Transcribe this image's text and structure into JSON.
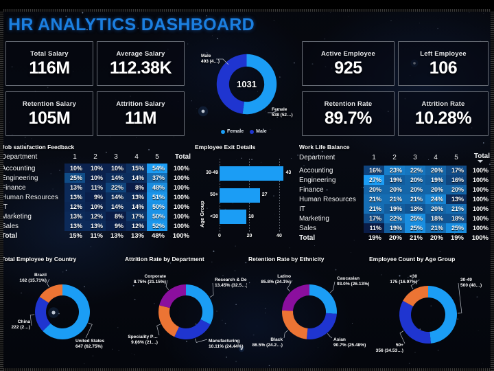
{
  "header": {
    "title": "HR ANALYTICS DASHBOARD",
    "accent": "#1b7fe0"
  },
  "kpis": [
    {
      "name": "total-salary",
      "label": "Total Salary",
      "value": "116M"
    },
    {
      "name": "average-salary",
      "label": "Average Salary",
      "value": "112.38K"
    },
    {
      "name": "retention-salary",
      "label": "Retention Salary",
      "value": "105M"
    },
    {
      "name": "attrition-salary",
      "label": "Attrition Salary",
      "value": "11M"
    },
    {
      "name": "active-employee",
      "label": "Active Employee",
      "value": "925"
    },
    {
      "name": "left-employee",
      "label": "Left Employee",
      "value": "106"
    },
    {
      "name": "retention-rate",
      "label": "Retention Rate",
      "value": "89.7%"
    },
    {
      "name": "attrition-rate",
      "label": "Attrition Rate",
      "value": "10.28%"
    }
  ],
  "gender_chart": {
    "type": "pie",
    "title": "",
    "center_total": "1031",
    "legend": [
      "Female",
      "Male"
    ],
    "legend_position": "bottom",
    "categories": [
      "Female",
      "Male"
    ],
    "values": [
      538,
      493
    ],
    "labels": [
      "Female\n538 (52…)",
      "Male\n493 (4…)"
    ],
    "female_label_line1": "Female",
    "female_label_line2": "538 (52…)",
    "male_label_line1": "Male",
    "male_label_line2": "493 (4…)",
    "colors": [
      "#1b9df5",
      "#1f35d0"
    ]
  },
  "job_satisfaction": {
    "title": "Job satisfaction Feedback",
    "col_department": "Department",
    "columns": [
      "1",
      "2",
      "3",
      "4",
      "5"
    ],
    "col_total": "Total",
    "rows": [
      {
        "department": "Accounting",
        "values": [
          "10%",
          "10%",
          "10%",
          "15%",
          "54%"
        ],
        "total": "100%"
      },
      {
        "department": "Engineering",
        "values": [
          "25%",
          "10%",
          "14%",
          "14%",
          "37%"
        ],
        "total": "100%"
      },
      {
        "department": "Finance",
        "values": [
          "13%",
          "11%",
          "22%",
          "8%",
          "48%"
        ],
        "total": "100%"
      },
      {
        "department": "Human Resources",
        "values": [
          "13%",
          "9%",
          "14%",
          "13%",
          "51%"
        ],
        "total": "100%"
      },
      {
        "department": "IT",
        "values": [
          "12%",
          "10%",
          "14%",
          "14%",
          "50%"
        ],
        "total": "100%"
      },
      {
        "department": "Marketing",
        "values": [
          "13%",
          "12%",
          "8%",
          "17%",
          "50%"
        ],
        "total": "100%"
      },
      {
        "department": "Sales",
        "values": [
          "13%",
          "13%",
          "9%",
          "12%",
          "52%"
        ],
        "total": "100%"
      }
    ],
    "total_row": {
      "department": "Total",
      "values": [
        "15%",
        "11%",
        "13%",
        "13%",
        "48%"
      ],
      "total": "100%"
    }
  },
  "work_life_balance": {
    "title": "Work Life Balance",
    "col_department": "Department",
    "columns": [
      "1",
      "2",
      "3",
      "4",
      "5"
    ],
    "col_total": "Total",
    "rows": [
      {
        "department": "Accounting",
        "values": [
          "16%",
          "23%",
          "22%",
          "20%",
          "17%"
        ],
        "total": "100%"
      },
      {
        "department": "Engineering",
        "values": [
          "27%",
          "19%",
          "20%",
          "19%",
          "16%"
        ],
        "total": "100%"
      },
      {
        "department": "Finance",
        "values": [
          "20%",
          "20%",
          "20%",
          "20%",
          "20%"
        ],
        "total": "100%"
      },
      {
        "department": "Human Resources",
        "values": [
          "21%",
          "21%",
          "21%",
          "24%",
          "13%"
        ],
        "total": "100%"
      },
      {
        "department": "IT",
        "values": [
          "21%",
          "19%",
          "18%",
          "20%",
          "21%"
        ],
        "total": "100%"
      },
      {
        "department": "Marketing",
        "values": [
          "17%",
          "22%",
          "25%",
          "18%",
          "18%"
        ],
        "total": "100%"
      },
      {
        "department": "Sales",
        "values": [
          "11%",
          "19%",
          "25%",
          "21%",
          "25%"
        ],
        "total": "100%"
      }
    ],
    "total_row": {
      "department": "Total",
      "values": [
        "19%",
        "20%",
        "21%",
        "20%",
        "19%"
      ],
      "total": "100%"
    }
  },
  "exit_details": {
    "type": "bar",
    "title": "Employee Exit Details",
    "ylabel": "Age Group",
    "xlabel": "",
    "orientation": "horizontal",
    "categories": [
      "30-49",
      "50+",
      "<30"
    ],
    "values": [
      43,
      27,
      18
    ],
    "data_labels": [
      "43",
      "27",
      "18"
    ],
    "ticks": [
      "0",
      "20",
      "40"
    ],
    "xlim": [
      0,
      46
    ],
    "grid": true,
    "bar_color": "#1b9df5"
  },
  "country_chart": {
    "type": "pie",
    "title": "Total Employee by Country",
    "categories": [
      "United States",
      "China",
      "Brazil"
    ],
    "values": [
      647,
      222,
      162
    ],
    "labels": [
      {
        "name": "United States",
        "text1": "United States",
        "text2": "647 (62.75%)"
      },
      {
        "name": "China",
        "text1": "China",
        "text2": "222 (2…)"
      },
      {
        "name": "Brazil",
        "text1": "Brazil",
        "text2": "162 (15.71%)"
      }
    ],
    "colors": [
      "#1b9df5",
      "#1f35d0",
      "#ec7434"
    ]
  },
  "attrition_dept_chart": {
    "type": "pie",
    "title": "Attrition Rate by Department",
    "categories": [
      "Research & De…",
      "Manufacturing",
      "Speciality P…",
      "Corporate"
    ],
    "values": [
      32.5,
      24.44,
      21.9,
      21.15
    ],
    "labels": [
      {
        "name": "research-development",
        "text1": "Research & De…",
        "text2": "13.45% (32.5…)"
      },
      {
        "name": "manufacturing",
        "text1": "Manufacturing",
        "text2": "10.11% (24.44%)"
      },
      {
        "name": "speciality-products",
        "text1": "Speciality P…",
        "text2": "9.06% (21…)"
      },
      {
        "name": "corporate",
        "text1": "Corporate",
        "text2": "8.75% (21.15%)"
      }
    ],
    "colors": [
      "#1b9df5",
      "#1f35d0",
      "#ec7434",
      "#8b0f9e"
    ]
  },
  "ethnicity_chart": {
    "type": "pie",
    "title": "Retention Rate by Ethnicity",
    "categories": [
      "Caucasian",
      "Asian",
      "Black",
      "Latino"
    ],
    "values": [
      26.13,
      25.48,
      24.2,
      24.1
    ],
    "labels": [
      {
        "name": "caucasian",
        "text1": "Caucasian",
        "text2": "93.0% (26.13%)"
      },
      {
        "name": "asian",
        "text1": "Asian",
        "text2": "90.7% (25.48%)"
      },
      {
        "name": "black",
        "text1": "Black",
        "text2": "86.5% (24.2…)"
      },
      {
        "name": "latino",
        "text1": "Latino",
        "text2": "85.8% (24.1%)"
      }
    ],
    "colors": [
      "#1b9df5",
      "#1f35d0",
      "#ec7434",
      "#8b0f9e"
    ]
  },
  "age_group_chart": {
    "type": "pie",
    "title": "Employee Count by Age Group",
    "categories": [
      "30-49",
      "50+",
      "<30"
    ],
    "values": [
      500,
      356,
      175
    ],
    "labels": [
      {
        "name": "age-30-49",
        "text1": "30-49",
        "text2": "500 (48…)"
      },
      {
        "name": "age-50plus",
        "text1": "50+",
        "text2": "356 (34.53…)"
      },
      {
        "name": "age-under30",
        "text1": "<30",
        "text2": "175 (16.97%)"
      }
    ],
    "colors": [
      "#1b9df5",
      "#1f35d0",
      "#ec7434"
    ]
  }
}
